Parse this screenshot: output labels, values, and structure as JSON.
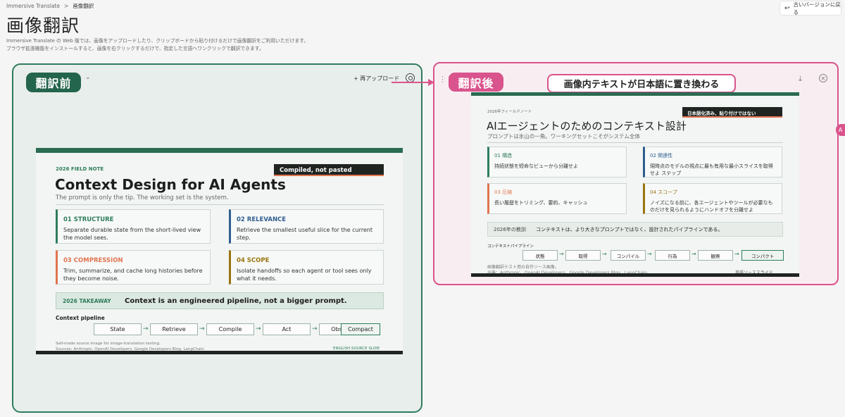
{
  "breadcrumb": {
    "root": "Immersive Translate",
    "separator": ">",
    "current": "画像翻訳"
  },
  "old_version_button": "古いバージョンに戻る",
  "page": {
    "title": "画像翻訳",
    "description_1": "Immersive Translate の Web 版では、画像をアップロードしたり、クリップボードから貼り付けるだけで画像翻訳をご利用いただけます。",
    "description_2": "ブラウザ拡張機能をインストールすると、画像を右クリックするだけで、指定した言語へワンクリックで翻訳できます。"
  },
  "before_panel": {
    "badge": "翻訳前",
    "reupload": "+ 再アップロード",
    "slide": {
      "tag": "2026 FIELD NOTE",
      "stamp": "Compiled, not pasted",
      "title": "Context Design for AI Agents",
      "subtitle": "The prompt is only the tip. The working set is the system.",
      "cards": [
        {
          "head": "01  STRUCTURE",
          "body": "Separate durable state from the short-lived view the model sees."
        },
        {
          "head": "02  RELEVANCE",
          "body": "Retrieve the smallest useful slice for the current step."
        },
        {
          "head": "03  COMPRESSION",
          "body": "Trim, summarize, and cache long histories before they become noise."
        },
        {
          "head": "04  SCOPE",
          "body": "Isolate handoffs so each agent or tool sees only what it needs."
        }
      ],
      "takeaway_label": "2026 TAKEAWAY",
      "takeaway_text": "Context is an engineered pipeline, not a bigger prompt.",
      "pipeline_label": "Context pipeline",
      "steps": [
        "State",
        "Retrieve",
        "Compile",
        "Act",
        "Observe",
        "Compact"
      ],
      "footnote_1": "Self-made source image for image-translation testing.",
      "footnote_2": "Sources: Anthropic, OpenAI Developers, Google Developers Blog, LangChain.",
      "footer_right": "ENGLISH SOURCE SLIDE"
    }
  },
  "after_panel": {
    "badge": "翻訳後",
    "callout": "画像内テキストが日本語に置き換わる",
    "slide": {
      "tag": "2026年フィールドノート",
      "stamp": "日本語化済み、貼り付けではない",
      "title": "AIエージェントのためのコンテキスト設計",
      "subtitle": "プロンプトは氷山の一角。ワーキングセットこそがシステム全体",
      "cards": [
        {
          "head": "01 構造",
          "body": "持続状態を短命なビューから分離せよ"
        },
        {
          "head": "02 関連性",
          "body": "現時点のモデルの視点に最も有用な最小スライスを取得せよ ステップ"
        },
        {
          "head": "03 圧縮",
          "body": "長い履歴をトリミング、要約、キャッシュ"
        },
        {
          "head": "04 スコープ",
          "body": "ノイズになる前に、各エージェントやツールが必要なものだけを見られるようにハンドオフを分離せよ"
        }
      ],
      "takeaway_label": "2026年の教訓",
      "takeaway_text": "コンテキストは、より大きなプロンプトではなく、設計されたパイプラインである。",
      "pipeline_label": "コンテキストパイプライン",
      "steps": [
        "状態",
        "取得",
        "コンパイル",
        "行為",
        "観察",
        "コンパクト"
      ],
      "footnote_1": "画像翻訳テスト用の自作ソース画像。",
      "footnote_2": "出典：Anthropic、OpenAI Developers、Google Developers Blog、LangChain。",
      "footer_right": "英語ソーススライド"
    }
  }
}
